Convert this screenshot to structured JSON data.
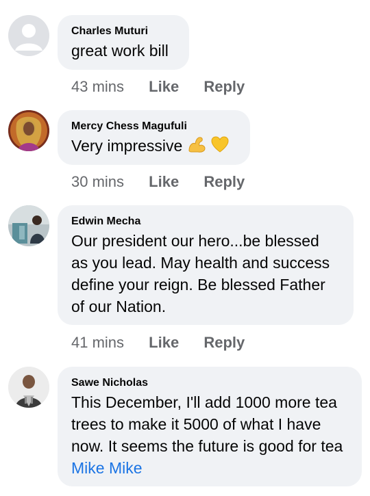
{
  "comments": [
    {
      "author": "Charles Muturi",
      "text": "great work bill",
      "time": "43 mins",
      "like": "Like",
      "reply": "Reply"
    },
    {
      "author": "Mercy Chess Magufuli",
      "text": "Very impressive",
      "emojis": [
        "flexed-biceps-icon",
        "yellow-heart-icon"
      ],
      "time": "30 mins",
      "like": "Like",
      "reply": "Reply"
    },
    {
      "author": "Edwin Mecha",
      "text": "Our president our hero...be blessed as you lead. May health and success define your reign. Be blessed Father of our Nation.",
      "time": "41 mins",
      "like": "Like",
      "reply": "Reply"
    },
    {
      "author": "Sawe Nicholas",
      "text": "This December, I'll add 1000 more tea trees to make it 5000 of  what I have now. It seems the future is good for tea",
      "mention": "Mike Mike"
    }
  ],
  "colors": {
    "bubble": "#f0f2f5",
    "meta": "#65676b",
    "mention": "#1b74e4"
  }
}
